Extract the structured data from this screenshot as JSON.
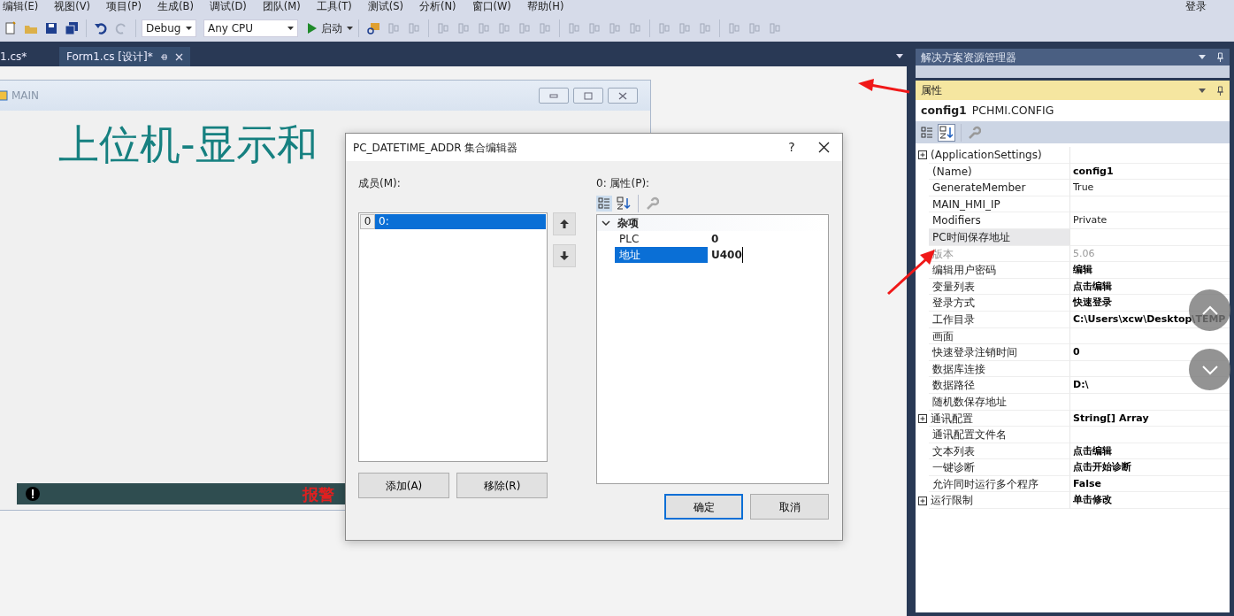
{
  "menu": [
    "编辑(E)",
    "视图(V)",
    "项目(P)",
    "生成(B)",
    "调试(D)",
    "团队(M)",
    "工具(T)",
    "测试(S)",
    "分析(N)",
    "窗口(W)",
    "帮助(H)"
  ],
  "account": "登录",
  "toolbar": {
    "configuration": "Debug",
    "platform": "Any CPU",
    "start": "启动"
  },
  "tabs": [
    {
      "label": "1.cs*",
      "selected": false
    },
    {
      "label": "Form1.cs [设计]*",
      "selected": true
    }
  ],
  "form": {
    "title": "MAIN",
    "heading": "上位机-显示和",
    "status": "报警"
  },
  "dialog": {
    "title": "PC_DATETIME_ADDR 集合编辑器",
    "help": "?",
    "members_label": "成员(M):",
    "members": [
      {
        "index": "0",
        "label": "0:",
        "selected": true
      }
    ],
    "add": "添加(A)",
    "remove": "移除(R)",
    "properties_label": "0: 属性(P):",
    "category": "杂项",
    "properties": [
      {
        "name": "PLC",
        "value": "0",
        "selected": false
      },
      {
        "name": "地址",
        "value": "U400",
        "selected": true
      }
    ],
    "ok": "确定",
    "cancel": "取消"
  },
  "solution_explorer": {
    "title": "解决方案资源管理器"
  },
  "properties_panel": {
    "title": "属性",
    "object_name": "config1",
    "object_type": "PCHMI.CONFIG",
    "rows": [
      {
        "name": "(ApplicationSettings)",
        "expandable": true,
        "readonly": false,
        "selected": false
      },
      {
        "name": "(Name)",
        "value": "config1",
        "expandable": false,
        "modified": true,
        "readonly": false,
        "selected": false
      },
      {
        "name": "GenerateMember",
        "value": "True",
        "expandable": false,
        "modified": false,
        "readonly": false,
        "selected": false
      },
      {
        "name": "MAIN_HMI_IP",
        "expandable": false,
        "readonly": false,
        "selected": false
      },
      {
        "name": "Modifiers",
        "value": "Private",
        "expandable": false,
        "modified": false,
        "readonly": false,
        "selected": false
      },
      {
        "name": "PC时间保存地址",
        "expandable": false,
        "readonly": false,
        "selected": true
      },
      {
        "name": "版本",
        "value": "5.06",
        "expandable": false,
        "modified": false,
        "readonly": true,
        "selected": false
      },
      {
        "name": "编辑用户密码",
        "value": "编辑",
        "expandable": false,
        "modified": true,
        "readonly": false,
        "selected": false
      },
      {
        "name": "变量列表",
        "value": "点击编辑",
        "expandable": false,
        "modified": true,
        "readonly": false,
        "selected": false
      },
      {
        "name": "登录方式",
        "value": "快速登录",
        "expandable": false,
        "modified": true,
        "readonly": false,
        "selected": false
      },
      {
        "name": "工作目录",
        "value": "C:\\Users\\xcw\\Desktop\\TEMP",
        "expandable": false,
        "modified": true,
        "readonly": false,
        "selected": false
      },
      {
        "name": "画面",
        "expandable": false,
        "readonly": false,
        "selected": false
      },
      {
        "name": "快速登录注销时间",
        "value": "0",
        "expandable": false,
        "modified": true,
        "readonly": false,
        "selected": false
      },
      {
        "name": "数据库连接",
        "expandable": false,
        "readonly": false,
        "selected": false
      },
      {
        "name": "数据路径",
        "value": "D:\\",
        "expandable": false,
        "modified": true,
        "readonly": false,
        "selected": false
      },
      {
        "name": "随机数保存地址",
        "expandable": false,
        "readonly": false,
        "selected": false
      },
      {
        "name": "通讯配置",
        "value": "String[] Array",
        "expandable": true,
        "modified": true,
        "readonly": false,
        "selected": false
      },
      {
        "name": "通讯配置文件名",
        "expandable": false,
        "readonly": false,
        "selected": false
      },
      {
        "name": "文本列表",
        "value": "点击编辑",
        "expandable": false,
        "modified": true,
        "readonly": false,
        "selected": false
      },
      {
        "name": "一键诊断",
        "value": "点击开始诊断",
        "expandable": false,
        "modified": true,
        "readonly": false,
        "selected": false
      },
      {
        "name": "允许同时运行多个程序",
        "value": "False",
        "expandable": false,
        "modified": true,
        "readonly": false,
        "selected": false
      },
      {
        "name": "运行限制",
        "value": "单击修改",
        "expandable": true,
        "modified": true,
        "readonly": false,
        "selected": false
      }
    ]
  }
}
